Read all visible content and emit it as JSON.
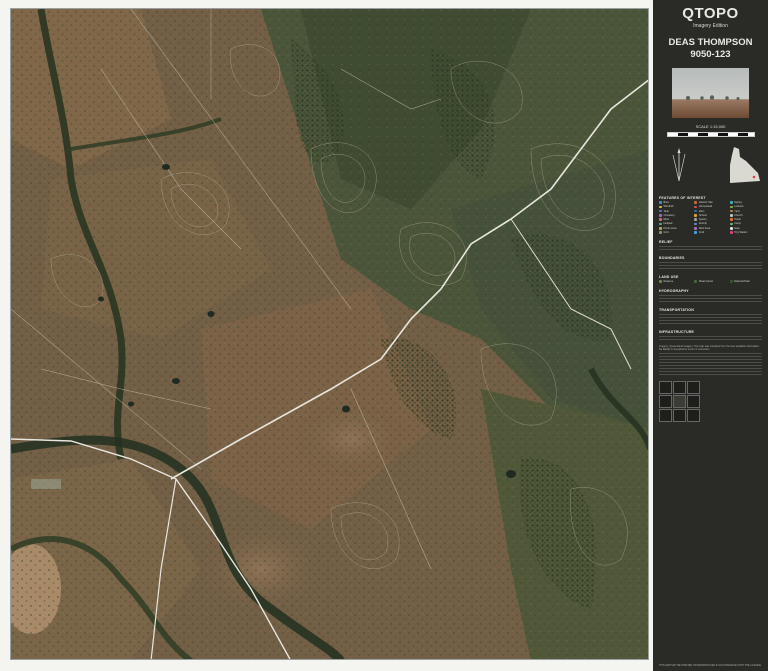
{
  "brand": "QTOPO",
  "edition": "Imagery Edition",
  "map_name": "DEAS THOMPSON",
  "map_number": "9050-123",
  "scale": "SCALE 1:15,000",
  "legend": {
    "sections": [
      "FEATURES OF INTEREST",
      "RELIEF",
      "BOUNDARIES",
      "LAND USE",
      "HYDROGRAPHY",
      "TRANSPORTATION",
      "INFRASTRUCTURE"
    ],
    "features": [
      {
        "label": "Bore",
        "color": "#3a8fd6"
      },
      {
        "label": "Historic Site",
        "color": "#c06a3a"
      },
      {
        "label": "Spring",
        "color": "#3ab0c8"
      },
      {
        "label": "Windmill",
        "color": "#d9c24a"
      },
      {
        "label": "Homestead",
        "color": "#e05050"
      },
      {
        "label": "Lookout",
        "color": "#8ab34a"
      },
      {
        "label": "Tank",
        "color": "#4a7acf"
      },
      {
        "label": "Dam",
        "color": "#2f6db5"
      },
      {
        "label": "Yard",
        "color": "#b88a4a"
      },
      {
        "label": "Cemetery",
        "color": "#9a6ac8"
      },
      {
        "label": "School",
        "color": "#e0a040"
      },
      {
        "label": "Church",
        "color": "#c0c0c0"
      },
      {
        "label": "Mine",
        "color": "#d06a6a"
      },
      {
        "label": "Quarry",
        "color": "#a0a0a0"
      },
      {
        "label": "Tower",
        "color": "#e07030"
      },
      {
        "label": "Helipad",
        "color": "#5ab0a0"
      },
      {
        "label": "Airstrip",
        "color": "#6a8ad0"
      },
      {
        "label": "Camp",
        "color": "#7ac070"
      },
      {
        "label": "Picnic Area",
        "color": "#c0a060"
      },
      {
        "label": "Rest Area",
        "color": "#a070c0"
      },
      {
        "label": "Gate",
        "color": "#e0e0e0"
      },
      {
        "label": "Grid",
        "color": "#909060"
      },
      {
        "label": "Ford",
        "color": "#40a0e0"
      },
      {
        "label": "Trig Station",
        "color": "#e04080"
      }
    ],
    "land_use": [
      {
        "label": "Reserve",
        "color": "#6a8a4a"
      },
      {
        "label": "State Forest",
        "color": "#3f6a3a"
      },
      {
        "label": "National Park",
        "color": "#2f5a30"
      }
    ]
  },
  "notes": "Imagery: Queensland Imagery. This map was compiled from the best available information. No liability is accepted for errors or omissions.",
  "footer": "THIS MAP MAY BE PRINTED OR REPRODUCED IN ACCORDANCE WITH THE LICENCE"
}
